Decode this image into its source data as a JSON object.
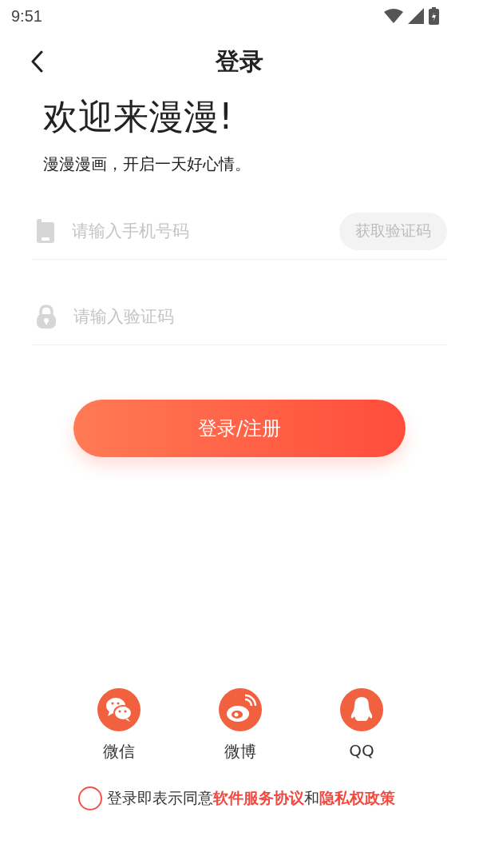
{
  "status_bar": {
    "time": "9:51"
  },
  "nav": {
    "title": "登录"
  },
  "welcome": {
    "heading": "欢迎来漫漫!",
    "subtitle": "漫漫漫画，开启一天好心情。"
  },
  "phone_field": {
    "placeholder": "请输入手机号码",
    "code_button": {
      "label": "获取验证码",
      "disabled": true
    }
  },
  "code_field": {
    "placeholder": "请输入验证码"
  },
  "submit_button": {
    "label": "登录/注册"
  },
  "social_logins": [
    {
      "kind": "wechat",
      "label": "微信"
    },
    {
      "kind": "weibo",
      "label": "微博"
    },
    {
      "kind": "qq",
      "label": "QQ"
    }
  ],
  "agreement": {
    "checked": false,
    "text": "登录即表示同意",
    "link_1": "软件服务协议",
    "joiner": "和",
    "link_2": "隐私权政策"
  }
}
